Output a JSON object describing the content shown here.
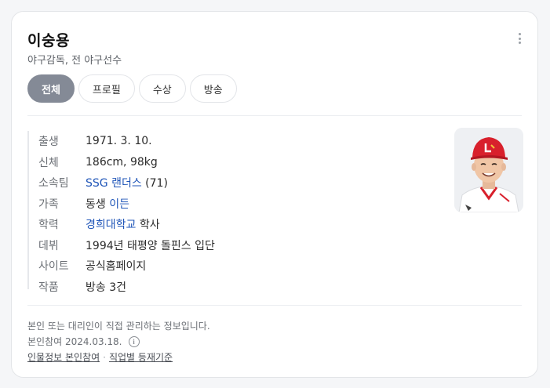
{
  "profile": {
    "name": "이숭용",
    "description": "야구감독, 전 야구선수"
  },
  "tabs": [
    {
      "label": "전체",
      "active": true
    },
    {
      "label": "프로필",
      "active": false
    },
    {
      "label": "수상",
      "active": false
    },
    {
      "label": "방송",
      "active": false
    }
  ],
  "info": {
    "birth": {
      "label": "출생",
      "value": "1971. 3. 10."
    },
    "body": {
      "label": "신체",
      "value": "186cm, 98kg"
    },
    "team": {
      "label": "소속팀",
      "link": "SSG 랜더스",
      "extra": " (71)"
    },
    "family": {
      "label": "가족",
      "prefix": "동생 ",
      "link": "이든"
    },
    "education": {
      "label": "학력",
      "link": "경희대학교",
      "extra": " 학사"
    },
    "debut": {
      "label": "데뷔",
      "value": "1994년 태평양 돌핀스 입단"
    },
    "site": {
      "label": "사이트",
      "link": "공식홈페이지"
    },
    "works": {
      "label": "작품",
      "link": "방송 3건"
    }
  },
  "footer": {
    "note": "본인 또는 대리인이 직접 관리하는 정보입니다.",
    "date": "본인참여 2024.03.18.",
    "link1": "인물정보 본인참여",
    "separator": "·",
    "link2": "직업별 등재기준"
  },
  "colors": {
    "link": "#1f55b8",
    "active_tab": "#848a96",
    "cap_red": "#d8202c"
  },
  "icons": {
    "more": "more-vertical-icon",
    "info": "info-circle-icon"
  }
}
